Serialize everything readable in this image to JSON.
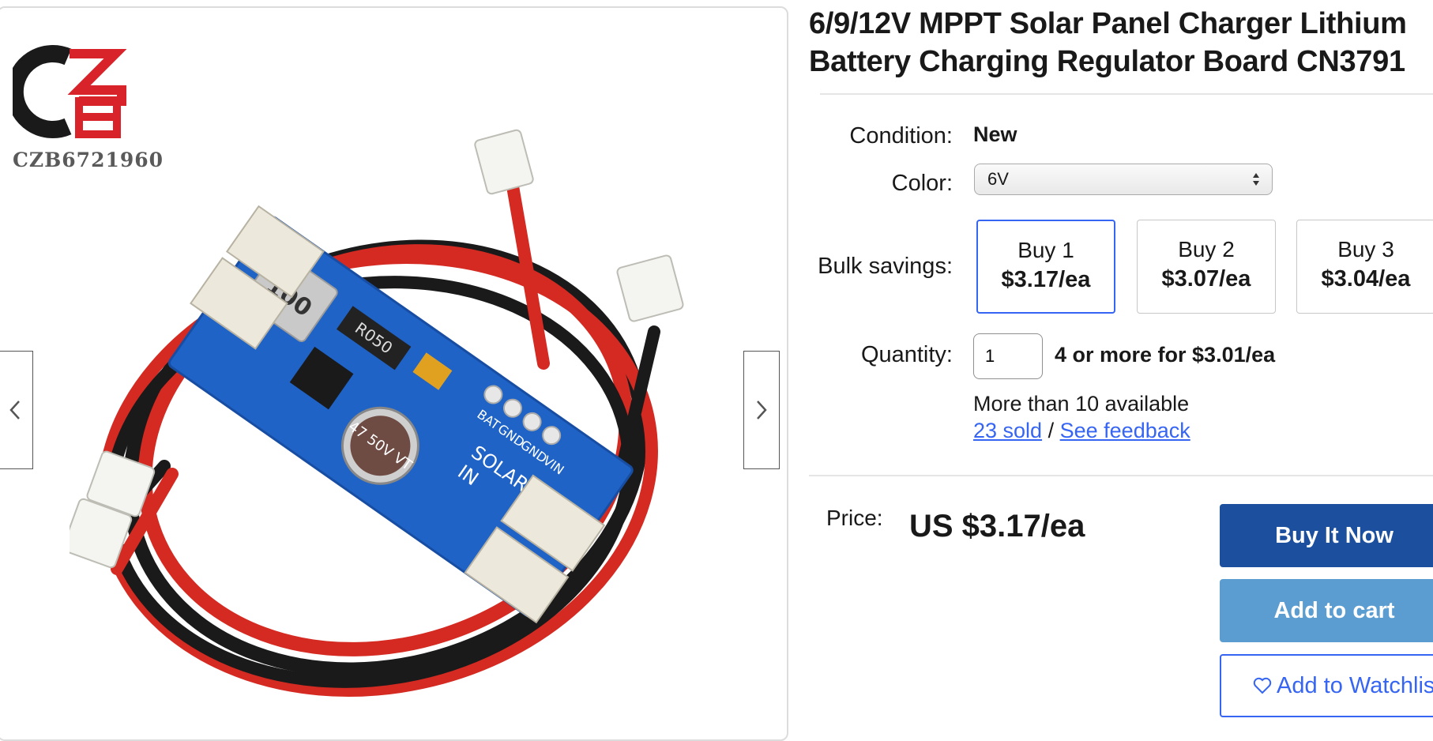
{
  "gallery": {
    "seller_watermark": "CZB6721960",
    "prev_icon": "chevron-left-icon",
    "next_icon": "chevron-right-icon",
    "board_labels": {
      "inductor": "100",
      "resistor": "R050",
      "cap": "47 50V VT",
      "bat": "BAT",
      "gnd1": "GND",
      "gnd2": "GND",
      "vin": "VIN",
      "solar": "SOLAR",
      "in": "IN"
    }
  },
  "product": {
    "title": "6/9/12V MPPT Solar Panel Charger Lithium Battery Charging Regulator Board CN3791"
  },
  "condition": {
    "label": "Condition:",
    "value": "New"
  },
  "color": {
    "label": "Color:",
    "selected": "6V"
  },
  "bulk": {
    "label": "Bulk savings:",
    "options": [
      {
        "qty": "Buy 1",
        "price": "$3.17/ea"
      },
      {
        "qty": "Buy 2",
        "price": "$3.07/ea"
      },
      {
        "qty": "Buy 3",
        "price": "$3.04/ea"
      }
    ]
  },
  "quantity": {
    "label": "Quantity:",
    "value": "1",
    "note": "4 or more for $3.01/ea",
    "available": "More than 10 available",
    "sold": "23 sold",
    "separator": "/",
    "feedback": "See feedback"
  },
  "price": {
    "label": "Price:",
    "value": "US $3.17/ea"
  },
  "actions": {
    "buy_now": "Buy It Now",
    "add_to_cart": "Add to cart",
    "watchlist": "Add to Watchlist",
    "watchlist_icon": "heart-icon"
  },
  "colors": {
    "link": "#3665f3",
    "buy_now_bg": "#1c509e",
    "add_to_cart_bg": "#5b9dd1",
    "board_blue": "#1f63c6",
    "wire_red": "#d42a22"
  }
}
